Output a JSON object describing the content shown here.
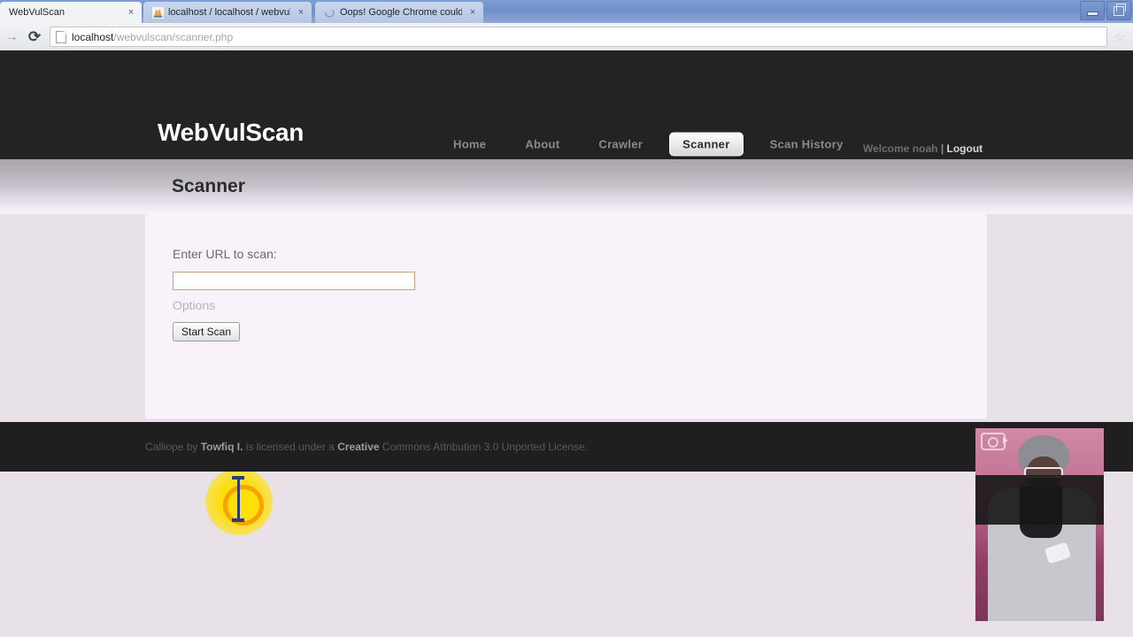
{
  "browser": {
    "tabs": [
      {
        "title": "WebVulScan",
        "favicon": "none",
        "active": true,
        "close_label": "×"
      },
      {
        "title": "localhost / localhost / webvul",
        "favicon": "phpmyadmin-icon",
        "active": false,
        "close_label": "×"
      },
      {
        "title": "Oops! Google Chrome could",
        "favicon": "spinner-icon",
        "active": false,
        "close_label": "×"
      }
    ],
    "toolbar": {
      "forward_glyph": "→",
      "reload_glyph": "⟳",
      "url_host": "localhost",
      "url_path": "/webvulscan/scanner.php",
      "star_glyph": "☆"
    },
    "window_controls": {
      "minimize": "minimize",
      "restore": "restore"
    }
  },
  "site": {
    "brand": "WebVulScan",
    "nav": [
      {
        "label": "Home",
        "active": false
      },
      {
        "label": "About",
        "active": false
      },
      {
        "label": "Crawler",
        "active": false
      },
      {
        "label": "Scanner",
        "active": true
      },
      {
        "label": "Scan History",
        "active": false
      }
    ],
    "user": {
      "welcome": "Welcome noah",
      "separator": "|",
      "logout": "Logout"
    },
    "page_title": "Scanner",
    "form": {
      "url_label": "Enter URL to scan:",
      "url_value": "",
      "url_placeholder": "",
      "options_label": "Options",
      "submit_label": "Start Scan"
    },
    "footer": {
      "prefix": "Calliope by ",
      "author": "Towfiq I.",
      "middle": " is licensed under a ",
      "license_strong": "Creative",
      "license_rest": " Commons Attribution 3.0 Unported License."
    }
  },
  "overlay": {
    "pip_label": "camera-overlay",
    "camera_icon": "camera-icon"
  },
  "colors": {
    "header_bg": "#232323",
    "panel_bg": "#faf2fa",
    "page_bg": "#e8e1e8",
    "input_border": "#c8a475",
    "click_highlight": "#ffe200",
    "cursor": "#2b3a7a"
  }
}
